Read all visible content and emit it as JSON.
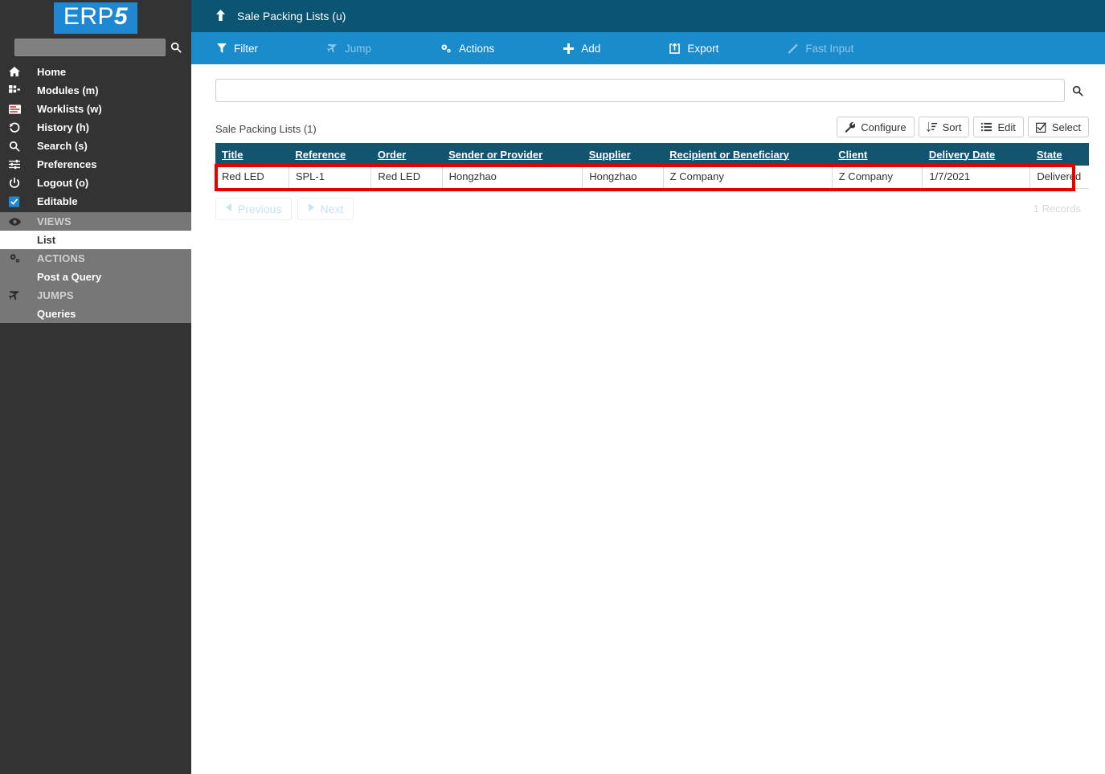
{
  "brand": {
    "logo_text": "ERP",
    "logo_text_accent": "5",
    "logo_bg": "#1e88d2"
  },
  "sidebar": {
    "search": {
      "value": "",
      "placeholder": "",
      "icon": "search-icon"
    },
    "items": [
      {
        "label": "Home",
        "icon": "home-icon"
      },
      {
        "label": "Modules (m)",
        "icon": "modules-icon"
      },
      {
        "label": "Worklists (w)",
        "icon": "worklists-icon"
      },
      {
        "label": "History (h)",
        "icon": "history-icon"
      },
      {
        "label": "Search (s)",
        "icon": "search-icon"
      },
      {
        "label": "Preferences",
        "icon": "sliders-icon"
      },
      {
        "label": "Logout (o)",
        "icon": "power-icon"
      },
      {
        "label": "Editable",
        "icon": "checkbox-checked-icon"
      }
    ],
    "groups": [
      {
        "heading": "VIEWS",
        "heading_icon": "eye-icon",
        "links": [
          {
            "label": "List",
            "selected": true
          }
        ]
      },
      {
        "heading": "ACTIONS",
        "heading_icon": "gears-icon",
        "links": [
          {
            "label": "Post a Query",
            "selected": false
          }
        ]
      },
      {
        "heading": "JUMPS",
        "heading_icon": "plane-icon",
        "links": [
          {
            "label": "Queries",
            "selected": false
          }
        ]
      }
    ]
  },
  "header": {
    "title": "Sale Packing Lists (u)",
    "up_icon": "arrow-up-icon",
    "bg": "#0b5472"
  },
  "actionbar": {
    "bg": "#1a8ccc",
    "items": [
      {
        "label": "Filter",
        "icon": "filter-icon",
        "disabled": false
      },
      {
        "label": "Jump",
        "icon": "plane-icon",
        "disabled": true
      },
      {
        "label": "Actions",
        "icon": "gears-icon",
        "disabled": false
      },
      {
        "label": "Add",
        "icon": "plus-icon",
        "disabled": false
      },
      {
        "label": "Export",
        "icon": "export-icon",
        "disabled": false
      },
      {
        "label": "Fast Input",
        "icon": "magic-wand-icon",
        "disabled": true
      }
    ]
  },
  "search": {
    "value": "",
    "placeholder": "",
    "button_icon": "search-icon"
  },
  "listing": {
    "title": "Sale Packing Lists (1)",
    "tools": [
      {
        "label": "Configure",
        "icon": "wrench-icon"
      },
      {
        "label": "Sort",
        "icon": "sort-icon"
      },
      {
        "label": "Edit",
        "icon": "list-icon"
      },
      {
        "label": "Select",
        "icon": "checkbox-icon"
      }
    ],
    "columns": [
      "Title",
      "Reference",
      "Order",
      "Sender or Provider",
      "Supplier",
      "Recipient or Beneficiary",
      "Client",
      "Delivery Date",
      "State"
    ],
    "rows": [
      {
        "title": "Red LED",
        "reference": "SPL-1",
        "order": "Red LED",
        "sender_or_provider": "Hongzhao",
        "supplier": "Hongzhao",
        "recipient_or_beneficiary": "Z Company",
        "client": "Z Company",
        "delivery_date": "1/7/2021",
        "state": "Delivered"
      }
    ],
    "highlight_color": "#e60000",
    "header_bg": "#13546f"
  },
  "pagination": {
    "previous_label": "Previous",
    "next_label": "Next",
    "previous_icon": "caret-left-icon",
    "next_icon": "caret-right-icon",
    "records": "1 Records"
  }
}
